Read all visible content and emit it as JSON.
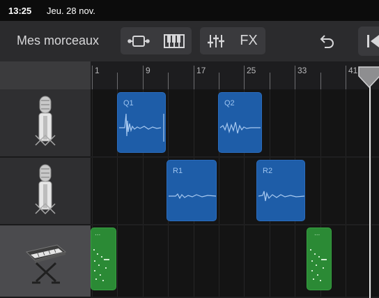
{
  "status": {
    "time": "13:25",
    "date": "Jeu. 28 nov."
  },
  "toolbar": {
    "songs_label": "Mes morceaux",
    "fx_label": "FX"
  },
  "ruler": {
    "bars": [
      "1",
      "9",
      "17",
      "25",
      "33",
      "41"
    ]
  },
  "tracks": [
    {
      "instrument": "microphone-icon",
      "regions": [
        {
          "label": "Q1",
          "kind": "audio"
        },
        {
          "label": "Q2",
          "kind": "audio"
        }
      ]
    },
    {
      "instrument": "microphone-icon",
      "regions": [
        {
          "label": "R1",
          "kind": "audio"
        },
        {
          "label": "R2",
          "kind": "audio"
        }
      ]
    },
    {
      "instrument": "keyboard-icon",
      "regions": [
        {
          "label": "...",
          "kind": "midi"
        },
        {
          "label": "...",
          "kind": "midi"
        }
      ]
    }
  ],
  "colors": {
    "audio_region": "#1e5da8",
    "midi_region": "#2b8a35",
    "control_bar": "#2b2b2d",
    "playhead": "#e5e5e5"
  }
}
